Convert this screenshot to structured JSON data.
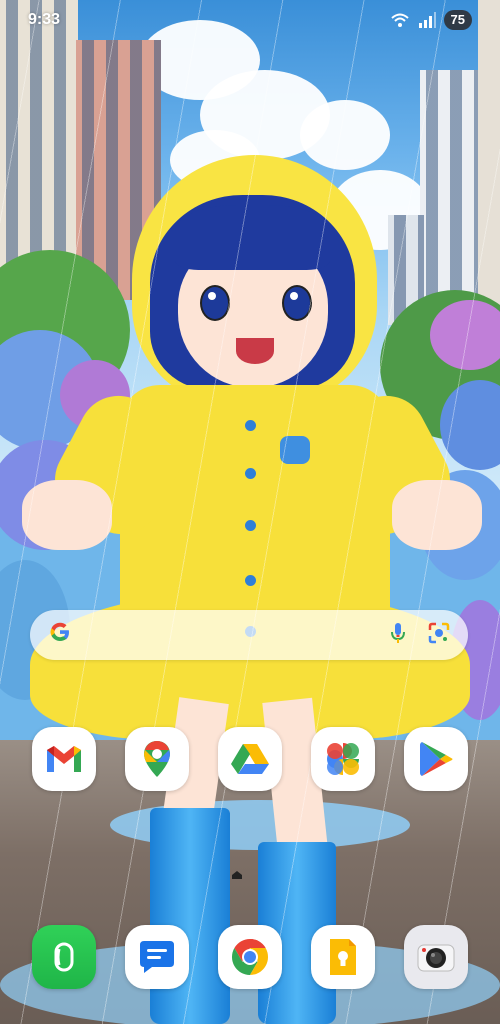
{
  "status_bar": {
    "time": "9:33",
    "battery": "75",
    "icons": [
      "wifi-icon",
      "signal-icon"
    ]
  },
  "search_bar": {
    "logo": "G",
    "icons": [
      "google-logo",
      "mic-icon",
      "lens-icon"
    ]
  },
  "home_apps": [
    {
      "name": "gmail",
      "icon": "gmail-icon"
    },
    {
      "name": "maps",
      "icon": "maps-icon"
    },
    {
      "name": "drive",
      "icon": "drive-icon"
    },
    {
      "name": "photos",
      "icon": "photos-icon"
    },
    {
      "name": "play-store",
      "icon": "play-store-icon"
    }
  ],
  "dock_apps": [
    {
      "name": "phone",
      "icon": "phone-icon"
    },
    {
      "name": "messages",
      "icon": "messages-icon"
    },
    {
      "name": "chrome",
      "icon": "chrome-icon"
    },
    {
      "name": "keep",
      "icon": "keep-icon"
    },
    {
      "name": "camera",
      "icon": "camera-icon"
    }
  ],
  "colors": {
    "raincoat": "#f7e03a",
    "hair": "#1f3a9e",
    "boots": "#2a95e8",
    "sky": "#6cb3ec"
  }
}
